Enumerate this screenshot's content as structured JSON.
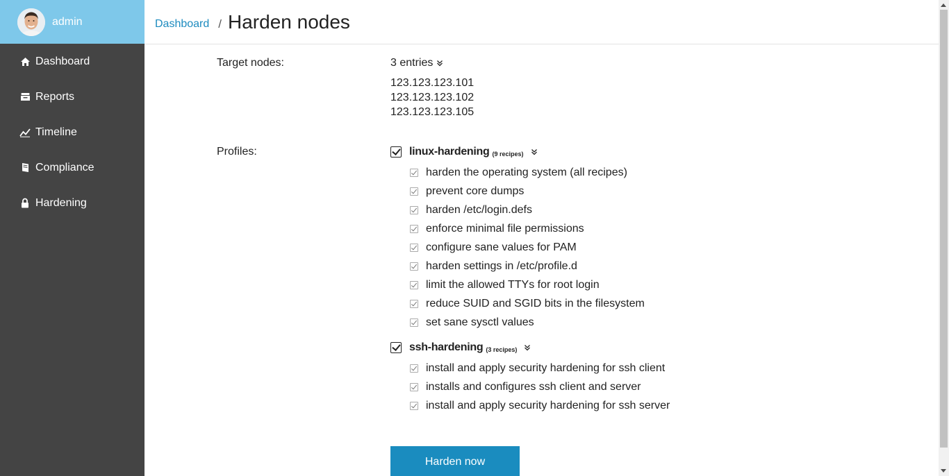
{
  "user": {
    "name": "admin"
  },
  "sidebar": {
    "items": [
      {
        "label": "Dashboard",
        "icon": "home-icon"
      },
      {
        "label": "Reports",
        "icon": "inbox-icon"
      },
      {
        "label": "Timeline",
        "icon": "trend-icon"
      },
      {
        "label": "Compliance",
        "icon": "book-icon"
      },
      {
        "label": "Hardening",
        "icon": "lock-icon"
      }
    ]
  },
  "breadcrumb": {
    "link": "Dashboard",
    "separator": "/",
    "title": "Harden nodes"
  },
  "target": {
    "label": "Target nodes:",
    "entries_label": "3 entries",
    "nodes": [
      "123.123.123.101",
      "123.123.123.102",
      "123.123.123.105"
    ]
  },
  "profiles": {
    "label": "Profiles:",
    "items": [
      {
        "name": "linux-hardening",
        "count": "(9 recipes)",
        "checked": true,
        "recipes": [
          "harden the operating system (all recipes)",
          "prevent core dumps",
          "harden /etc/login.defs",
          "enforce minimal file permissions",
          "configure sane values for PAM",
          "harden settings in /etc/profile.d",
          "limit the allowed TTYs for root login",
          "reduce SUID and SGID bits in the filesystem",
          "set sane sysctl values"
        ]
      },
      {
        "name": "ssh-hardening",
        "count": "(3 recipes)",
        "checked": true,
        "recipes": [
          "install and apply security hardening for ssh client",
          "installs and configures ssh client and server",
          "install and apply security hardening for ssh server"
        ]
      }
    ]
  },
  "actions": {
    "harden_label": "Harden now"
  },
  "colors": {
    "sidebar_bg": "#444444",
    "user_bg": "#7ec8ea",
    "accent": "#1a8cbf"
  }
}
